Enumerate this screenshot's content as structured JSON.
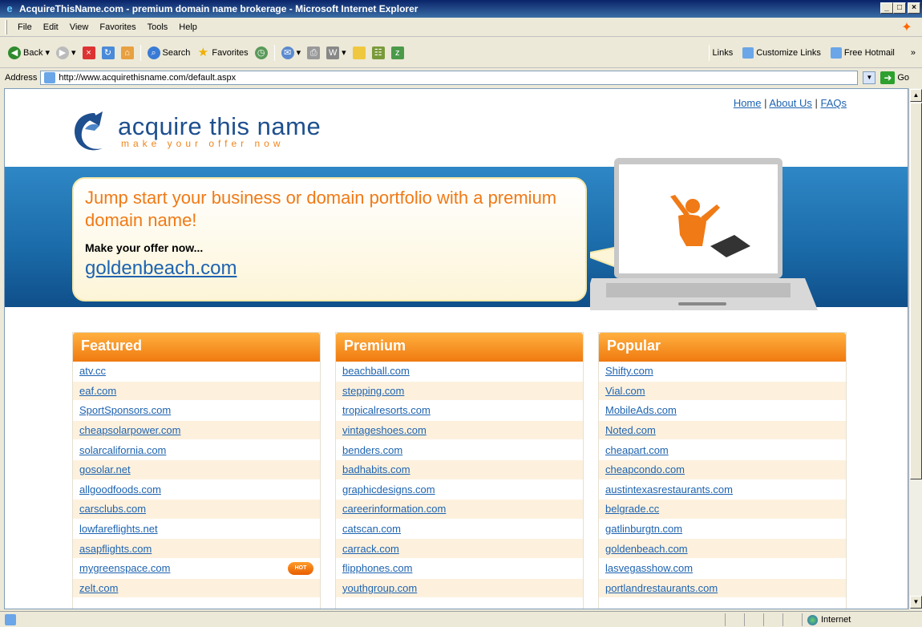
{
  "window": {
    "title": "AcquireThisName.com - premium domain name brokerage - Microsoft Internet Explorer"
  },
  "menu": [
    "File",
    "Edit",
    "View",
    "Favorites",
    "Tools",
    "Help"
  ],
  "toolbar": {
    "back": "Back",
    "search": "Search",
    "favorites": "Favorites"
  },
  "links": {
    "label": "Links",
    "customize": "Customize Links",
    "hotmail": "Free Hotmail"
  },
  "address": {
    "label": "Address",
    "url": "http://www.acquirethisname.com/default.aspx",
    "go": "Go"
  },
  "page": {
    "nav": [
      "Home",
      "About Us",
      "FAQs"
    ],
    "logo_name": "acquire this name",
    "logo_tagline": "make your offer now",
    "headline": "Jump start your business or domain portfolio with a premium domain name!",
    "offer_label": "Make your offer now...",
    "offer_domain": "goldenbeach.com",
    "hot_badge": "HOT",
    "columns": [
      {
        "title": "Featured",
        "items": [
          "atv.cc",
          "eaf.com",
          "SportSponsors.com",
          "cheapsolarpower.com",
          "solarcalifornia.com",
          "gosolar.net",
          "allgoodfoods.com",
          "carsclubs.com",
          "lowfareflights.net",
          "asapflights.com",
          "mygreenspace.com",
          "zelt.com"
        ]
      },
      {
        "title": "Premium",
        "items": [
          "beachball.com",
          "stepping.com",
          "tropicalresorts.com",
          "vintageshoes.com",
          "benders.com",
          "badhabits.com",
          "graphicdesigns.com",
          "careerinformation.com",
          "catscan.com",
          "carrack.com",
          "flipphones.com",
          "youthgroup.com"
        ]
      },
      {
        "title": "Popular",
        "items": [
          "Shifty.com",
          "Vial.com",
          "MobileAds.com",
          "Noted.com",
          "cheapart.com",
          "cheapcondo.com",
          "austintexasrestaurants.com",
          "belgrade.cc",
          "gatlinburgtn.com",
          "goldenbeach.com",
          "lasvegasshow.com",
          "portlandrestaurants.com"
        ]
      }
    ]
  },
  "status": {
    "zone": "Internet"
  }
}
